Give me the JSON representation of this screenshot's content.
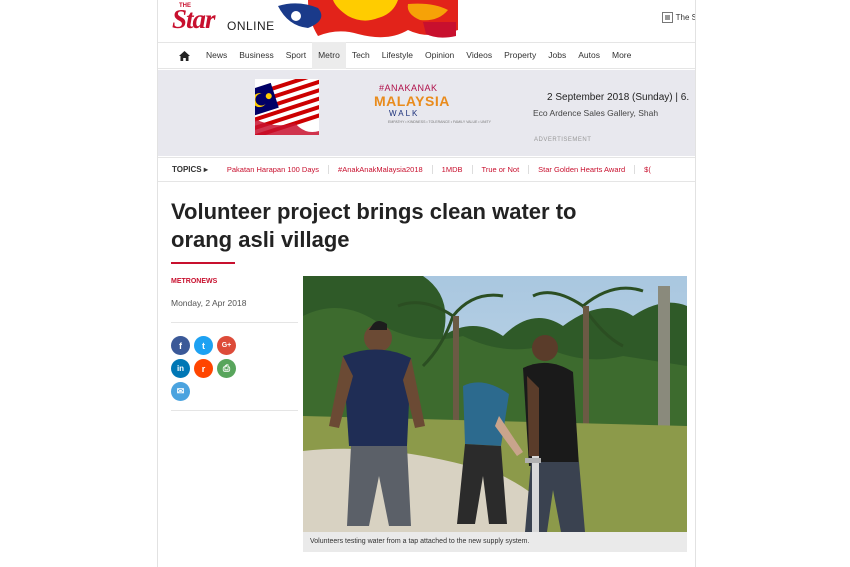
{
  "brand": {
    "the": "THE",
    "star": "Star",
    "online": "ONLINE",
    "ts_link": "The S"
  },
  "nav": [
    "News",
    "Business",
    "Sport",
    "Metro",
    "Tech",
    "Lifestyle",
    "Opinion",
    "Videos",
    "Property",
    "Jobs",
    "Autos",
    "More"
  ],
  "nav_active": "Metro",
  "ad": {
    "hashtag": "#ANAKANAK",
    "malaysia": "MALAYSIA",
    "walk": "WALK",
    "sub": "EMPATHY • KINDNESS • TOLERANCE • FAMILY VALUE • UNITY",
    "date": "2 September 2018 (Sunday) | 6.",
    "venue": "Eco Ardence Sales Gallery, Shah",
    "label": "ADVERTISEMENT"
  },
  "topics": {
    "label": "TOPICS ▸",
    "items": [
      "Pakatan Harapan 100 Days",
      "#AnakAnakMalaysia2018",
      "1MDB",
      "True or Not",
      "Star Golden Hearts Award",
      "$("
    ]
  },
  "article": {
    "headline": "Volunteer project brings clean water to orang asli village",
    "section": "METRONEWS",
    "date": "Monday, 2 Apr 2018",
    "caption": "Volunteers testing water from a tap attached to the new supply system."
  },
  "share": [
    {
      "name": "facebook",
      "glyph": "f",
      "color": "#3b5998"
    },
    {
      "name": "twitter",
      "glyph": "t",
      "color": "#1da1f2"
    },
    {
      "name": "google-plus",
      "glyph": "G+",
      "color": "#dd4b39"
    },
    {
      "name": "linkedin",
      "glyph": "in",
      "color": "#0077b5"
    },
    {
      "name": "reddit",
      "glyph": "r",
      "color": "#ff4500"
    },
    {
      "name": "print",
      "glyph": "⎙",
      "color": "#58a55c"
    },
    {
      "name": "email",
      "glyph": "✉",
      "color": "#4aa3df"
    }
  ],
  "colors": {
    "brand_red": "#c8102e",
    "topic_red": "#c8102e"
  }
}
